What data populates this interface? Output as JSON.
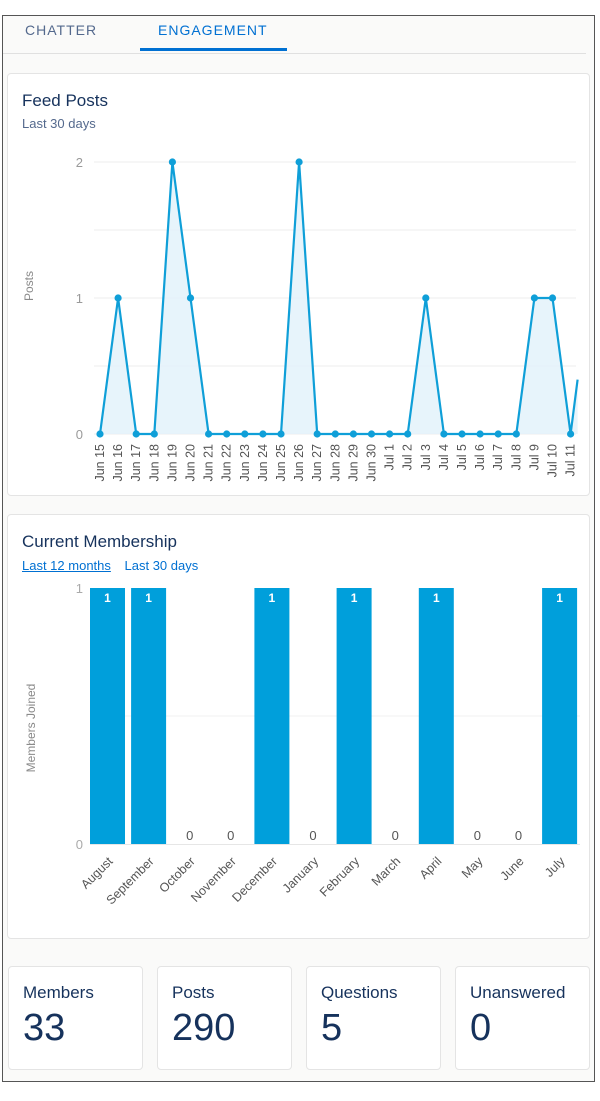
{
  "tabs": [
    {
      "label": "CHATTER",
      "active": false
    },
    {
      "label": "ENGAGEMENT",
      "active": true
    }
  ],
  "feed_posts": {
    "title": "Feed Posts",
    "subtitle": "Last 30 days"
  },
  "membership": {
    "title": "Current Membership",
    "filters": [
      {
        "label": "Last 12 months",
        "active": true
      },
      {
        "label": "Last 30 days",
        "active": false
      }
    ]
  },
  "stats": [
    {
      "label": "Members",
      "value": "33"
    },
    {
      "label": "Posts",
      "value": "290"
    },
    {
      "label": "Questions",
      "value": "5"
    },
    {
      "label": "Unanswered",
      "value": "0"
    }
  ],
  "colors": {
    "accent": "#0070d2",
    "series": "#0f9fd8",
    "bar": "#009fdb",
    "area": "#e3f2fa",
    "text": "#16325c"
  },
  "chart_data": [
    {
      "type": "area",
      "title": "Feed Posts",
      "subtitle": "Last 30 days",
      "xlabel": "",
      "ylabel": "Posts",
      "ylim": [
        0,
        2
      ],
      "yticks": [
        0,
        1,
        2
      ],
      "grid": true,
      "x": [
        "Jun 15",
        "Jun 16",
        "Jun 17",
        "Jun 18",
        "Jun 19",
        "Jun 20",
        "Jun 21",
        "Jun 22",
        "Jun 23",
        "Jun 24",
        "Jun 25",
        "Jun 26",
        "Jun 27",
        "Jun 28",
        "Jun 29",
        "Jun 30",
        "Jul 1",
        "Jul 2",
        "Jul 3",
        "Jul 4",
        "Jul 5",
        "Jul 6",
        "Jul 7",
        "Jul 8",
        "Jul 9",
        "Jul 10",
        "Jul 11"
      ],
      "values": [
        0,
        1,
        0,
        0,
        2,
        1,
        0,
        0,
        0,
        0,
        0,
        2,
        0,
        0,
        0,
        0,
        0,
        0,
        1,
        0,
        0,
        0,
        0,
        0,
        1,
        1,
        0
      ],
      "truncated_trailing_rise": true
    },
    {
      "type": "bar",
      "title": "Current Membership",
      "xlabel": "",
      "ylabel": "Members Joined",
      "ylim": [
        0,
        1
      ],
      "yticks": [
        0,
        1
      ],
      "grid": true,
      "categories": [
        "August",
        "September",
        "October",
        "November",
        "December",
        "January",
        "February",
        "March",
        "April",
        "May",
        "June",
        "July"
      ],
      "values": [
        1,
        1,
        0,
        0,
        1,
        0,
        1,
        0,
        1,
        0,
        0,
        1
      ],
      "data_labels": true
    }
  ]
}
